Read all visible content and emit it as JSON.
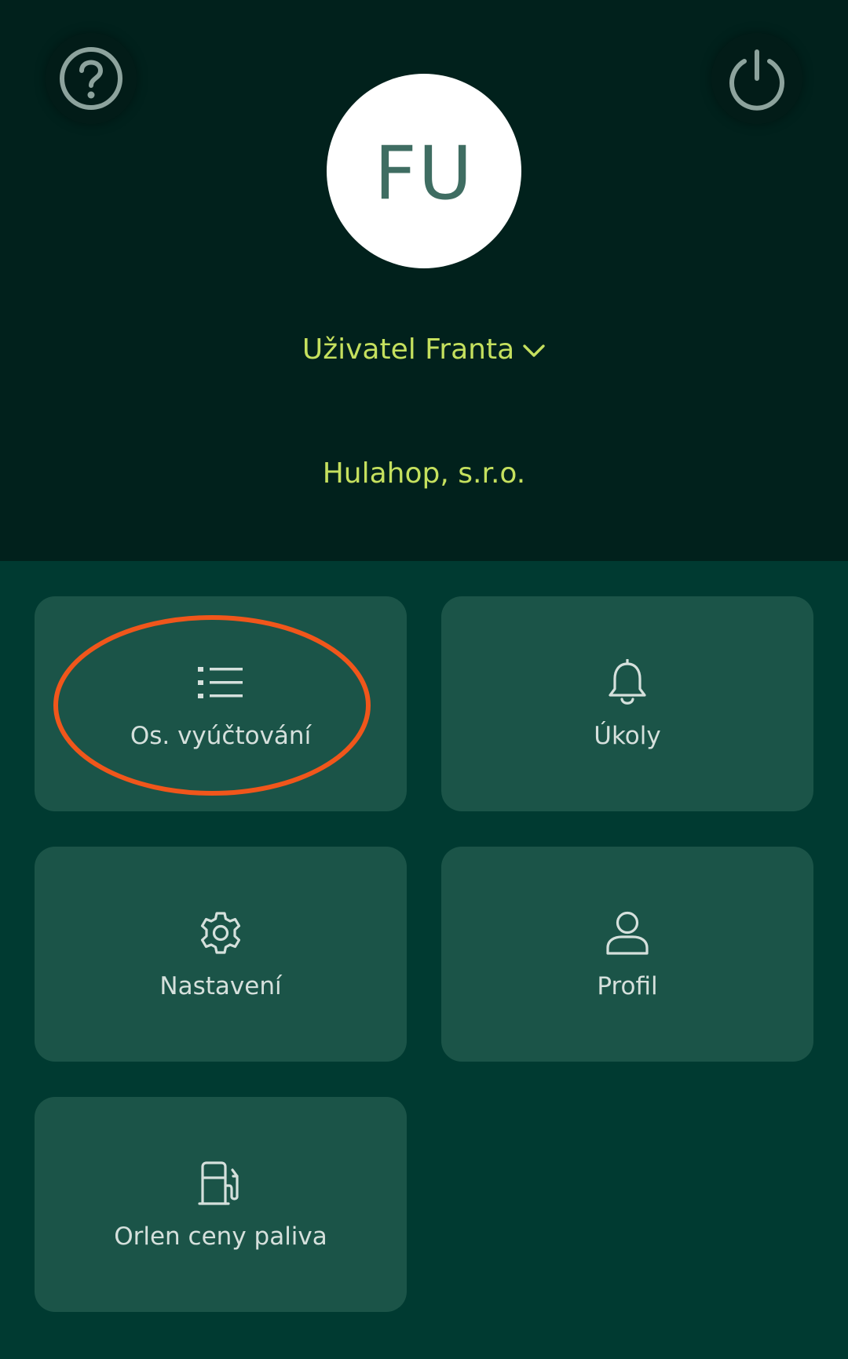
{
  "header": {
    "help_icon": "question-circle-icon",
    "power_icon": "power-icon",
    "avatar_initials": "FU",
    "user_name": "Uživatel Franta",
    "company_name": "Hulahop, s.r.o."
  },
  "menu": {
    "items": [
      {
        "label": "Os. vyúčtování",
        "icon": "list-icon"
      },
      {
        "label": "Úkoly",
        "icon": "bell-icon"
      },
      {
        "label": "Nastavení",
        "icon": "gear-icon"
      },
      {
        "label": "Profil",
        "icon": "user-icon"
      },
      {
        "label": "Orlen ceny paliva",
        "icon": "fuel-pump-icon"
      }
    ]
  },
  "colors": {
    "header_bg": "#01211c",
    "body_bg": "#003a31",
    "tile_bg": "#1b5448",
    "accent_text": "#c5e05e",
    "highlight_ring": "#f0561b"
  }
}
